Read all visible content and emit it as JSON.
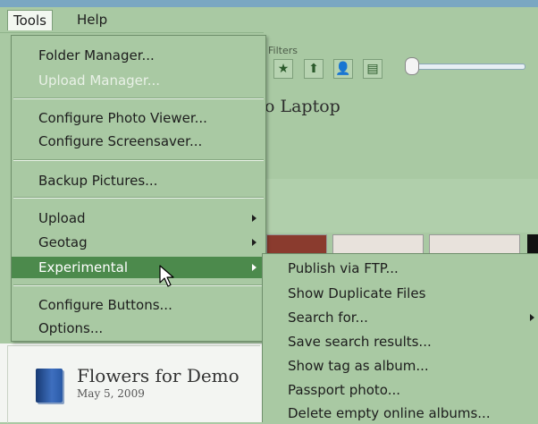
{
  "menubar": {
    "items": [
      {
        "label": "Tools",
        "active": true
      },
      {
        "label": "Help",
        "active": false
      }
    ]
  },
  "background": {
    "filters_label": "Filters",
    "filter_icons": [
      "star-icon",
      "up-arrow-icon",
      "person-icon",
      "film-icon"
    ],
    "title_fragment": "o Laptop",
    "album": {
      "title": "Flowers for Demo",
      "date": "May 5, 2009"
    }
  },
  "tools_menu": {
    "items": [
      {
        "label": "Folder Manager...",
        "enabled": true
      },
      {
        "label": "Upload Manager...",
        "enabled": false
      },
      {
        "label": "Configure Photo Viewer...",
        "enabled": true
      },
      {
        "label": "Configure Screensaver...",
        "enabled": true
      },
      {
        "label": "Backup Pictures...",
        "enabled": true
      },
      {
        "label": "Upload",
        "enabled": true,
        "submenu": true
      },
      {
        "label": "Geotag",
        "enabled": true,
        "submenu": true
      },
      {
        "label": "Experimental",
        "enabled": true,
        "submenu": true,
        "highlighted": true
      },
      {
        "label": "Configure Buttons...",
        "enabled": true
      },
      {
        "label": "Options...",
        "enabled": true
      }
    ]
  },
  "experimental_submenu": {
    "items": [
      {
        "label": "Publish via FTP..."
      },
      {
        "label": "Show Duplicate Files"
      },
      {
        "label": "Search for...",
        "submenu": true
      },
      {
        "label": "Save search results..."
      },
      {
        "label": "Show tag as album..."
      },
      {
        "label": "Passport photo..."
      },
      {
        "label": "Delete empty online albums..."
      }
    ]
  },
  "colors": {
    "menu_bg": "#a9c9a3",
    "highlight": "#4c8a4c",
    "disabled_text": "#e9f1e7"
  }
}
